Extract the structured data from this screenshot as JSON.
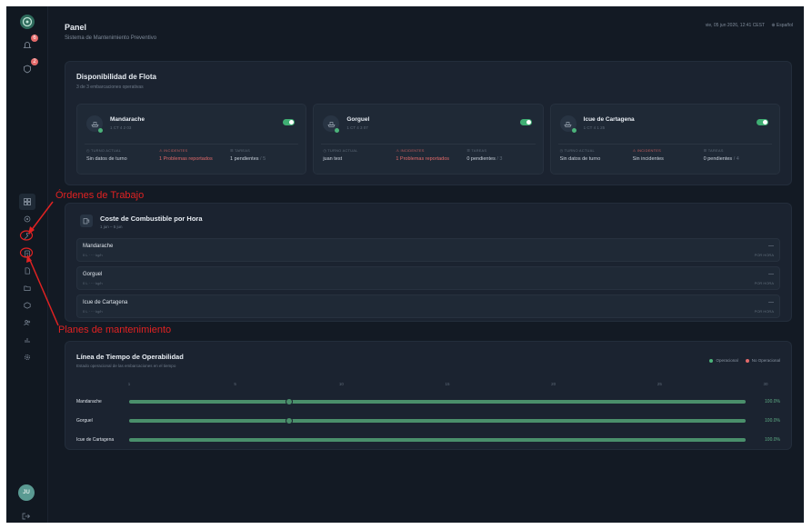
{
  "header": {
    "title": "Panel",
    "subtitle": "Sistema de Mantenimiento Preventivo",
    "datetime": "vie, 05 jun 2026, 12:41 CEST",
    "language": "Español"
  },
  "sidebar": {
    "badges": {
      "bell": "6",
      "shield": "2"
    },
    "avatar": "JU",
    "nav_icons": [
      "grid-icon",
      "helm-icon",
      "wrench-icon",
      "clipboard-icon",
      "file-icon",
      "folder-icon",
      "box-icon",
      "users-icon",
      "chart-icon",
      "settings-icon"
    ]
  },
  "fleet": {
    "title": "Disponibilidad de Flota",
    "subtitle": "3 de 3 embarcaciones operativas",
    "vessels": [
      {
        "name": "Mandarache",
        "code": "1 CT 4 2 03",
        "turn_label": "TURNO ACTUAL",
        "turn_value": "Sin datos de turno",
        "inc_label": "INCIDENTES",
        "inc_value": "1 Problemas reportados",
        "task_label": "TAREAS",
        "task_value": "1 pendientes",
        "task_total": "/ 5"
      },
      {
        "name": "Gorguel",
        "code": "1 CT 4 3 07",
        "turn_label": "TURNO ACTUAL",
        "turn_value": "juan test",
        "inc_label": "INCIDENTES",
        "inc_value": "1 Problemas reportados",
        "task_label": "TAREAS",
        "task_value": "0 pendientes",
        "task_total": "/ 3"
      },
      {
        "name": "Icue de Cartagena",
        "code": "1 CT 4 1 25",
        "turn_label": "TURNO ACTUAL",
        "turn_value": "Sin datos de turno",
        "inc_label": "INCIDENTES",
        "inc_value": "Sin incidentes",
        "task_label": "TAREAS",
        "task_value": "0 pendientes",
        "task_total": "/ 4"
      }
    ]
  },
  "fuel": {
    "title": "Coste de Combustible por Hora",
    "range": "1 jun – 5 jun",
    "rows": [
      {
        "name": "Mandarache",
        "sub": "0 L · ··· kg/h",
        "value": "—",
        "unit": "POR HORA"
      },
      {
        "name": "Gorguel",
        "sub": "0 L · ··· kg/h",
        "value": "—",
        "unit": "POR HORA"
      },
      {
        "name": "Icue de Cartagena",
        "sub": "0 L · ··· kg/h",
        "value": "—",
        "unit": "POR HORA"
      }
    ]
  },
  "timeline": {
    "title": "Línea de Tiempo de Operabilidad",
    "subtitle": "Estado operacional de las embarcaciones en el tiempo",
    "legend_op": "Operacional",
    "legend_noop": "No Operacional",
    "ticks": [
      "1",
      "5",
      "10",
      "15",
      "20",
      "25",
      "30"
    ],
    "rows": [
      {
        "name": "Mandarache",
        "pct": "100.0%",
        "operational": 1.0,
        "marker": 0.26
      },
      {
        "name": "Gorguel",
        "pct": "100.0%",
        "operational": 1.0,
        "marker": 0.26
      },
      {
        "name": "Icue de Cartagena",
        "pct": "100.0%",
        "operational": 1.0,
        "marker": null
      }
    ]
  },
  "annotations": {
    "work_orders": "Órdenes de Trabajo",
    "maintenance_plans": "Planes de mantenimiento"
  },
  "colors": {
    "background": "#131a24",
    "card": "#1b2330",
    "operational": "#4a8f6b",
    "toggle": "#3fae73",
    "alert": "#e36a6a",
    "annotation": "#e02222"
  }
}
